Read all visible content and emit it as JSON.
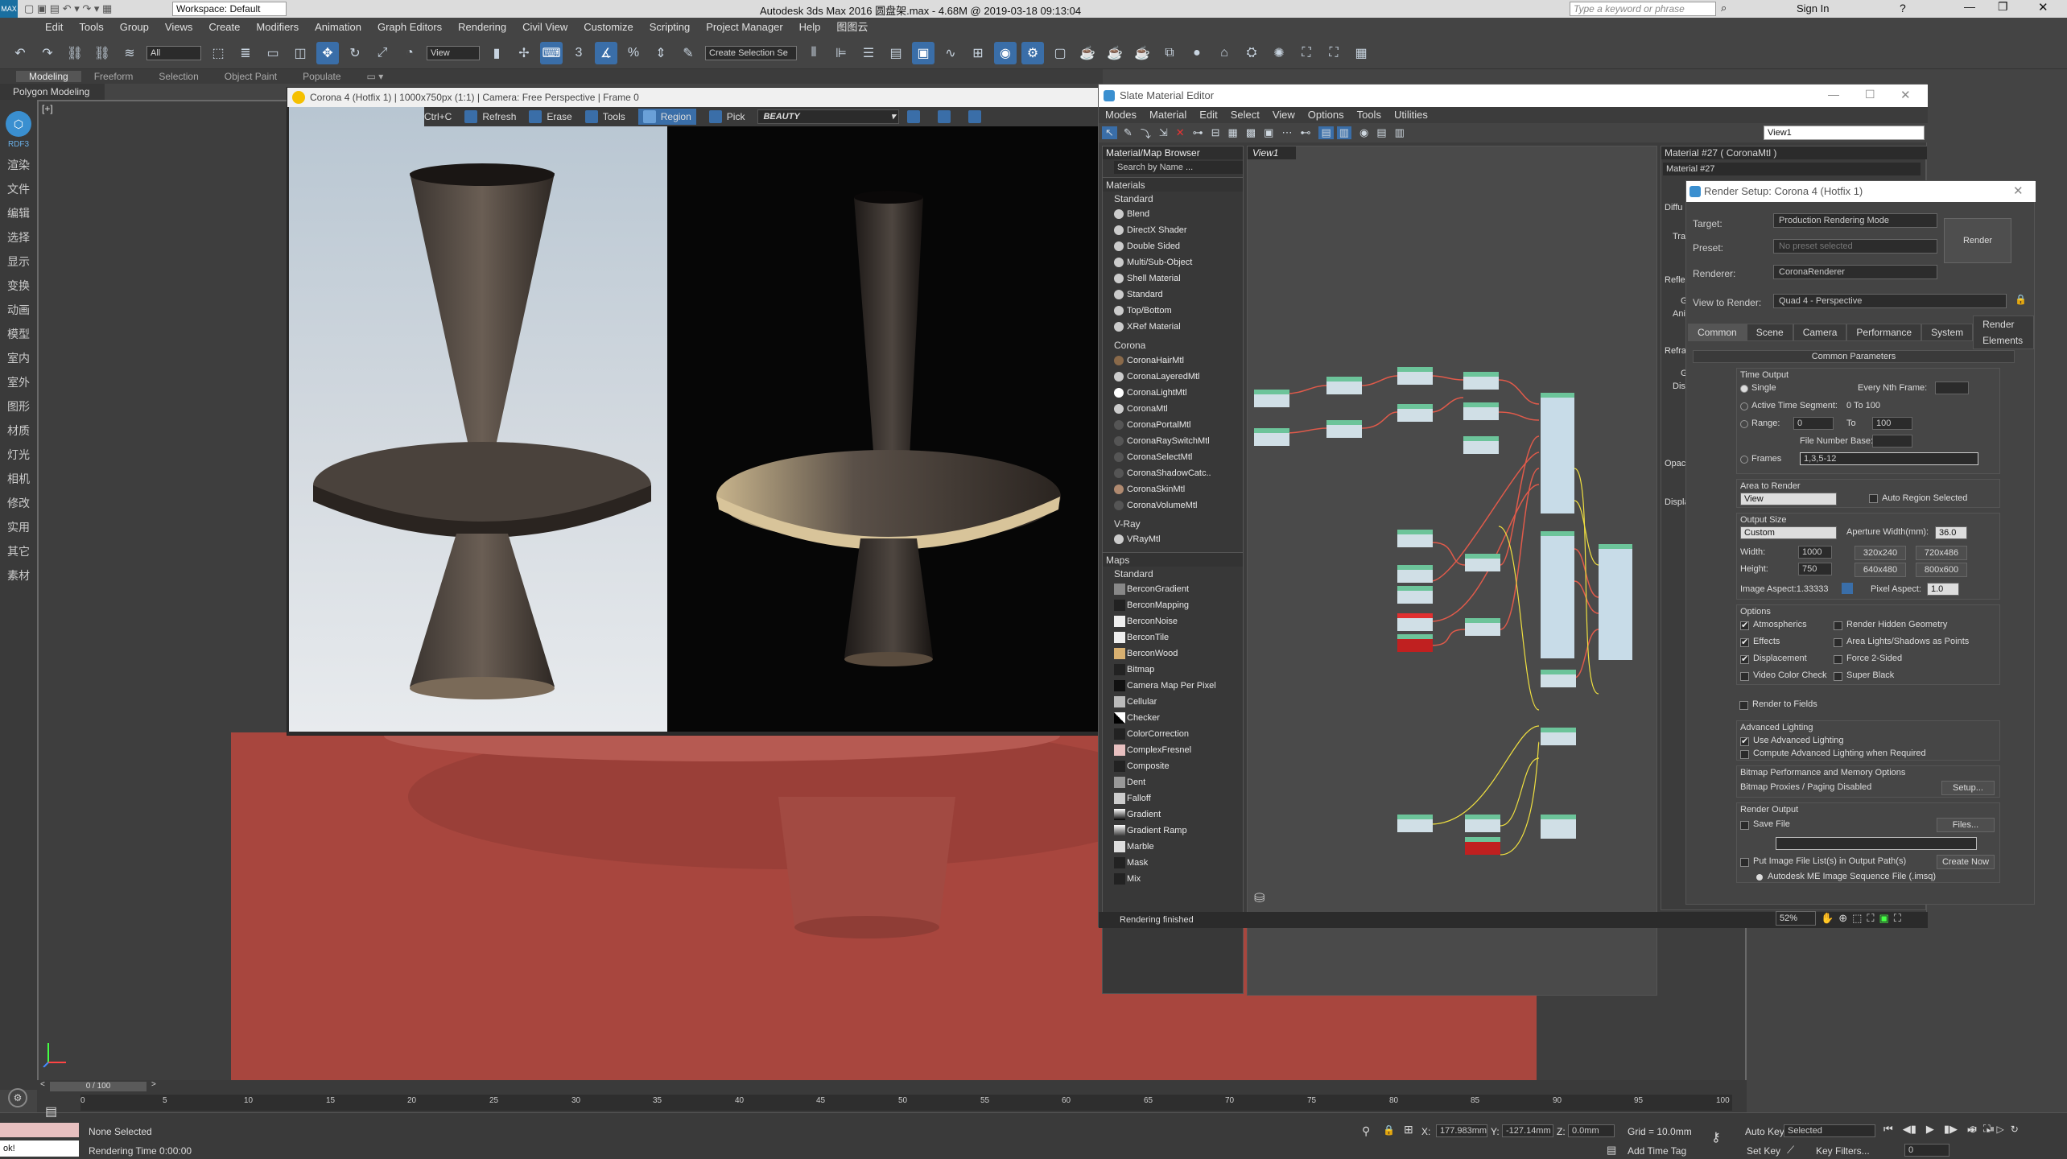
{
  "titlebar": {
    "workspace": "Workspace: Default",
    "title": "Autodesk 3ds Max 2016     圆盘架.max - 4.68M @ 2019-03-18 09:13:04",
    "search_placeholder": "Type a keyword or phrase",
    "signin": "Sign In"
  },
  "menu": [
    "Edit",
    "Tools",
    "Group",
    "Views",
    "Create",
    "Modifiers",
    "Animation",
    "Graph Editors",
    "Rendering",
    "Civil View",
    "Customize",
    "Scripting",
    "Project Manager",
    "Help",
    "图图云"
  ],
  "toolbar": {
    "selection_filter": "All",
    "ref_coord": "View",
    "named_sel": "Create Selection Se"
  },
  "ribbon": {
    "tabs": [
      "Modeling",
      "Freeform",
      "Selection",
      "Object Paint",
      "Populate"
    ],
    "active": "Modeling",
    "sub": "Polygon Modeling"
  },
  "leftbar": [
    "RDF3",
    "渲染",
    "文件",
    "编辑",
    "选择",
    "显示",
    "变换",
    "动画",
    "模型",
    "室内",
    "室外",
    "图形",
    "材质",
    "灯光",
    "相机",
    "修改",
    "实用",
    "其它",
    "素材"
  ],
  "vfb": {
    "title": "Corona 4 (Hotfix 1) | 1000x750px (1:1) | Camera: Free Perspective | Frame 0",
    "tools": [
      "Ctrl+C",
      "Refresh",
      "Erase",
      "Tools",
      "Region",
      "Pick"
    ],
    "channel": "BEAUTY"
  },
  "slate": {
    "title": "Slate Material Editor",
    "menu": [
      "Modes",
      "Material",
      "Edit",
      "Select",
      "View",
      "Options",
      "Tools",
      "Utilities"
    ],
    "view_select": "View1",
    "browser_title": "Material/Map Browser",
    "search": "Search by Name ...",
    "materials_label": "Materials",
    "standard_label": "Standard",
    "standard": [
      "Blend",
      "DirectX Shader",
      "Double Sided",
      "Multi/Sub-Object",
      "Shell Material",
      "Standard",
      "Top/Bottom",
      "XRef Material"
    ],
    "corona_label": "Corona",
    "corona": [
      "CoronaHairMtl",
      "CoronaLayeredMtl",
      "CoronaLightMtl",
      "CoronaMtl",
      "CoronaPortalMtl",
      "CoronaRaySwitchMtl",
      "CoronaSelectMtl",
      "CoronaShadowCatc..",
      "CoronaSkinMtl",
      "CoronaVolumeMtl"
    ],
    "vray_label": "V-Ray",
    "vray": [
      "VRayMtl"
    ],
    "maps_label": "Maps",
    "maps_standard_label": "Standard",
    "maps": [
      "BerconGradient",
      "BerconMapping",
      "BerconNoise",
      "BerconTile",
      "BerconWood",
      "Bitmap",
      "Camera Map Per Pixel",
      "Cellular",
      "Checker",
      "ColorCorrection",
      "ComplexFresnel",
      "Composite",
      "Dent",
      "Falloff",
      "Gradient",
      "Gradient Ramp",
      "Marble",
      "Mask",
      "Mix"
    ],
    "view_tab": "View1",
    "material_title": "Material #27  ( CoronaMtl )",
    "material_name": "Material #27",
    "side_labels": [
      "Diffu",
      "Tran",
      "Refle",
      "G",
      "Anis",
      "Refra",
      "G",
      "Disp",
      "Opaci",
      "Displa"
    ],
    "status": "Rendering finished"
  },
  "render_setup": {
    "title": "Render Setup: Corona 4 (Hotfix 1)",
    "target_label": "Target:",
    "target": "Production Rendering Mode",
    "preset_label": "Preset:",
    "preset": "No preset selected",
    "renderer_label": "Renderer:",
    "renderer": "CoronaRenderer",
    "render_btn": "Render",
    "view_label": "View to Render:",
    "view": "Quad 4 - Perspective",
    "tabs": [
      "Common",
      "Scene",
      "Camera",
      "Performance",
      "System",
      "Render Elements"
    ],
    "section": "Common Parameters",
    "time_output": "Time Output",
    "single": "Single",
    "every_nth": "Every Nth Frame:",
    "active_segment": "Active Time Segment:",
    "active_range": "0 To 100",
    "range": "Range:",
    "range_from": "0",
    "to": "To",
    "range_to": "100",
    "file_number_base": "File Number Base:",
    "frames": "Frames",
    "frames_val": "1,3,5-12",
    "area_label": "Area to Render",
    "area": "View",
    "auto_region": "Auto Region Selected",
    "output_size": "Output Size",
    "size_preset": "Custom",
    "aperture": "Aperture Width(mm):",
    "aperture_val": "36.0",
    "width": "Width:",
    "width_val": "1000",
    "height": "Height:",
    "height_val": "750",
    "presets": [
      "320x240",
      "720x486",
      "640x480",
      "800x600"
    ],
    "image_aspect": "Image Aspect:1.33333",
    "pixel_aspect": "Pixel Aspect:",
    "pixel_aspect_val": "1.0",
    "options": "Options",
    "opt_left": [
      "Atmospherics",
      "Effects",
      "Displacement",
      "Video Color Check",
      "Render to Fields"
    ],
    "opt_right": [
      "Render Hidden Geometry",
      "Area Lights/Shadows as Points",
      "Force 2-Sided",
      "Super Black"
    ],
    "adv_lighting": "Advanced Lighting",
    "use_adv": "Use Advanced Lighting",
    "compute_adv": "Compute Advanced Lighting when Required",
    "bitmap_perf": "Bitmap Performance and Memory Options",
    "bitmap_proxies": "Bitmap Proxies / Paging Disabled",
    "setup_btn": "Setup...",
    "render_output": "Render Output",
    "save_file": "Save File",
    "files_btn": "Files...",
    "put_image": "Put Image File List(s) in Output Path(s)",
    "create_now": "Create Now",
    "autodesk_me": "Autodesk ME Image Sequence File (.imsq)"
  },
  "timeline": {
    "frame": "0 / 100",
    "ticks": [
      "0",
      "5",
      "10",
      "15",
      "20",
      "25",
      "30",
      "35",
      "40",
      "45",
      "50",
      "55",
      "60",
      "65",
      "70",
      "75",
      "80",
      "85",
      "90",
      "95",
      "100"
    ]
  },
  "status": {
    "none_selected": "None Selected",
    "rendering_time": "Rendering Time  0:00:00",
    "maxscript": "ok!",
    "x": "177.983mm",
    "y": "-127.14mm",
    "z": "0.0mm",
    "grid": "Grid = 10.0mm",
    "add_time_tag": "Add Time Tag",
    "auto_key": "Auto Key",
    "set_key": "Set Key",
    "selected": "Selected",
    "key_filters": "Key Filters...",
    "frame": "0",
    "zoom": "52%"
  },
  "colors": {
    "accent": "#3a6ea8",
    "floor": "#a8463e",
    "node_header": "#6cc49a"
  }
}
